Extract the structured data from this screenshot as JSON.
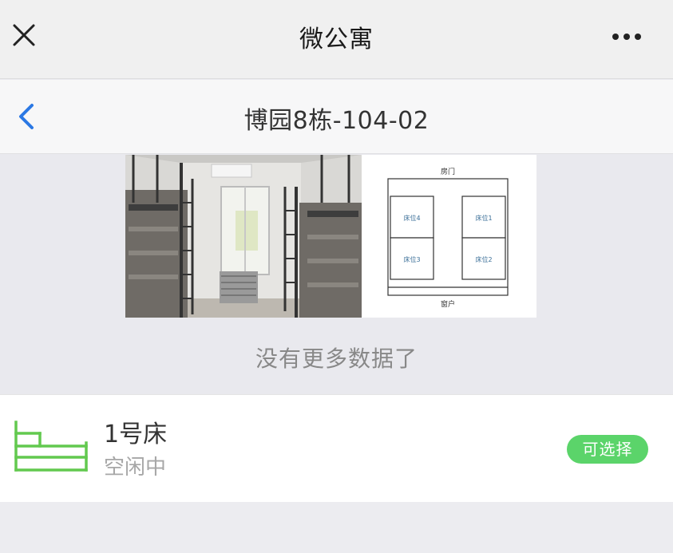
{
  "wechat_bar": {
    "title": "微公寓",
    "close_icon": "close-icon",
    "more_icon": "more-dots-icon"
  },
  "header": {
    "back_icon": "chevron-left-icon",
    "title": "博园8栋-104-02"
  },
  "room_images": {
    "photo": "dorm-room-photo",
    "floorplan": {
      "top_label": "房门",
      "bottom_label": "窗户",
      "beds": [
        "床位4",
        "床位1",
        "床位3",
        "床位2"
      ]
    }
  },
  "list_end_text": "没有更多数据了",
  "beds": [
    {
      "name": "1号床",
      "status": "空闲中",
      "action": "可选择",
      "icon": "bed-icon"
    }
  ],
  "colors": {
    "accent_green": "#5bd46a",
    "back_blue": "#2b78e4"
  }
}
